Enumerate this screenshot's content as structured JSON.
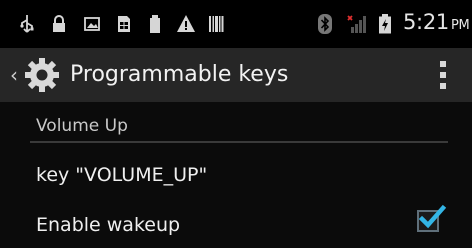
{
  "status_bar": {
    "time": "5:21",
    "ampm": "PM",
    "icons": [
      "usb-icon",
      "lock-icon",
      "image-icon",
      "sim-card-icon",
      "battery-saver-icon",
      "warning-icon",
      "barcode-icon",
      "bluetooth-icon",
      "no-signal-icon",
      "battery-charging-icon"
    ]
  },
  "action_bar": {
    "title": "Programmable keys"
  },
  "content": {
    "category_title": "Volume Up",
    "key_label": "key \"VOLUME_UP\"",
    "wakeup_label": "Enable wakeup",
    "wakeup_checked": true
  },
  "colors": {
    "accent": "#33b5e5",
    "action_bar_bg": "#262626",
    "background": "#0b0b0b"
  }
}
